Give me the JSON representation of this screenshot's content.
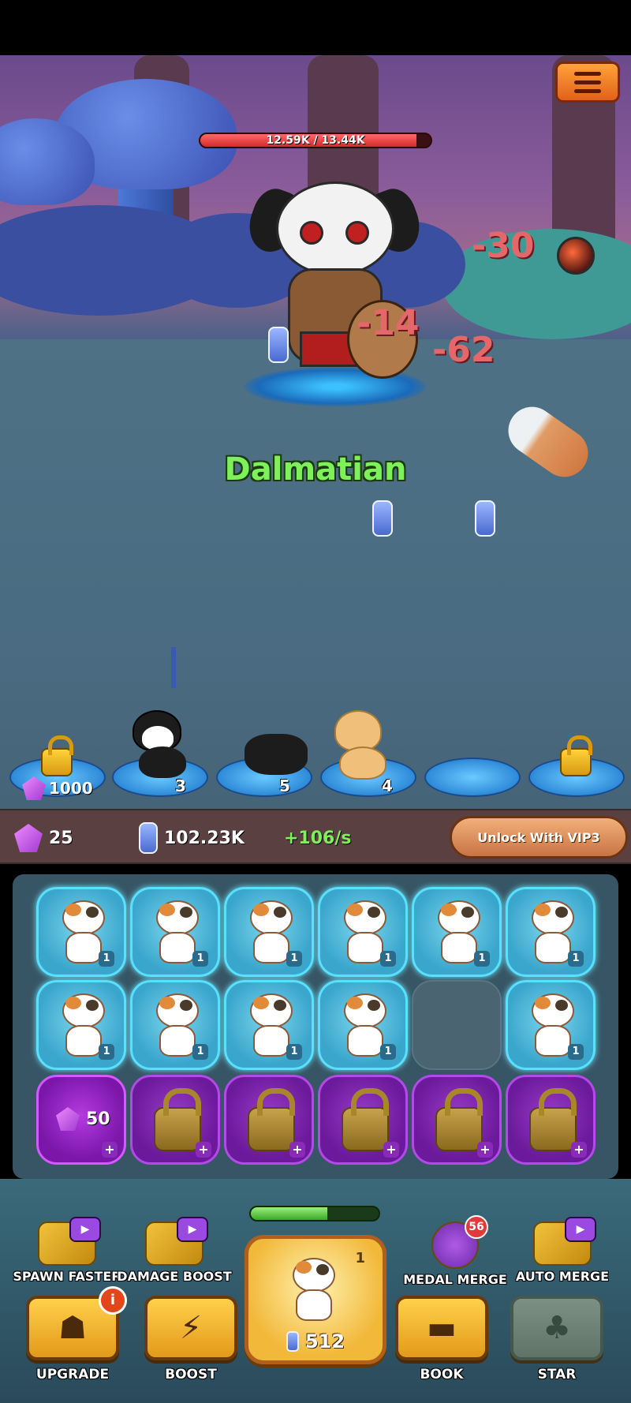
{
  "battle": {
    "hp_text": "12.59K / 13.44K",
    "hp_fraction": 0.937,
    "enemy_name": "Dalmatian",
    "damage_numbers": [
      "-30",
      "-14",
      "-62"
    ]
  },
  "slots": [
    {
      "type": "locked",
      "cost": "1000"
    },
    {
      "type": "cat",
      "level": "3",
      "color": "#1c1c1c"
    },
    {
      "type": "cat",
      "level": "5",
      "color": "#1c1c1c"
    },
    {
      "type": "cat",
      "level": "4",
      "color": "#f0c07a"
    },
    {
      "type": "empty"
    },
    {
      "type": "locked"
    }
  ],
  "resources": {
    "gems": "25",
    "coins": "102.23K",
    "rate": "+106/s",
    "vip_label": "Unlock With VIP3"
  },
  "grid": {
    "row1_levels": [
      "1",
      "1",
      "1",
      "1",
      "1",
      "1"
    ],
    "row2_levels": [
      "1",
      "1",
      "1",
      "1",
      "",
      "1"
    ],
    "gem_cell_cost": "50",
    "plus": "+"
  },
  "boosts": {
    "spawn_faster": "SPAWN FASTER",
    "damage_boost": "DAMAGE BOOST",
    "medal_merge": "MEDAL MERGE",
    "medal_count": "56",
    "auto_merge": "AUTO MERGE",
    "progress_fraction": 0.6
  },
  "spawn": {
    "level": "1",
    "cost": "512"
  },
  "actions": {
    "upgrade": "UPGRADE",
    "upgrade_badge": "i",
    "boost": "BOOST",
    "book": "BOOK",
    "star": "STAR"
  },
  "icons": {
    "menu": "hamburger-menu-icon",
    "gem": "gem-icon",
    "coin": "paw-coin-icon",
    "lock": "lock-icon",
    "play": "video-play-icon"
  },
  "colors": {
    "enemy_name": "#7ef05a",
    "hp_bar": "#d22a2a",
    "damage": "#e4686a",
    "rate": "#7ef05a"
  }
}
